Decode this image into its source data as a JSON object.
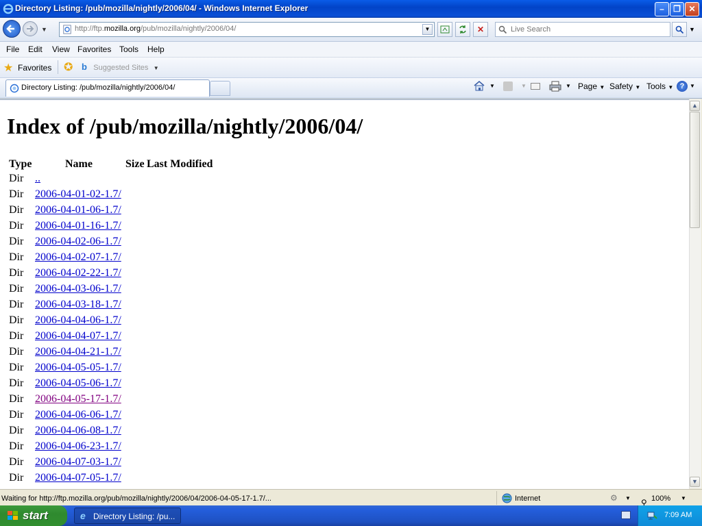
{
  "window": {
    "title": "Directory Listing: /pub/mozilla/nightly/2006/04/ - Windows Internet Explorer",
    "min_glyph": "–",
    "max_glyph": "❐",
    "close_glyph": "✕"
  },
  "navbar": {
    "url_prefix": "http://ftp.",
    "url_host": "mozilla.org",
    "url_path": "/pub/mozilla/nightly/2006/04/",
    "search_placeholder": "Live Search"
  },
  "menu": {
    "items": [
      "File",
      "Edit",
      "View",
      "Favorites",
      "Tools",
      "Help"
    ]
  },
  "favorites_bar": {
    "favorites_label": "Favorites",
    "suggested_label": "Suggested Sites"
  },
  "tabs": {
    "active_label": "Directory Listing: /pub/mozilla/nightly/2006/04/"
  },
  "command_bar": {
    "page": "Page",
    "safety": "Safety",
    "tools": "Tools"
  },
  "page": {
    "heading": "Index of /pub/mozilla/nightly/2006/04/",
    "columns": [
      "Type",
      "Name",
      "Size",
      "Last Modified"
    ],
    "rows": [
      {
        "type": "Dir",
        "name": ".."
      },
      {
        "type": "Dir",
        "name": "2006-04-01-02-1.7/"
      },
      {
        "type": "Dir",
        "name": "2006-04-01-06-1.7/"
      },
      {
        "type": "Dir",
        "name": "2006-04-01-16-1.7/"
      },
      {
        "type": "Dir",
        "name": "2006-04-02-06-1.7/"
      },
      {
        "type": "Dir",
        "name": "2006-04-02-07-1.7/"
      },
      {
        "type": "Dir",
        "name": "2006-04-02-22-1.7/"
      },
      {
        "type": "Dir",
        "name": "2006-04-03-06-1.7/"
      },
      {
        "type": "Dir",
        "name": "2006-04-03-18-1.7/"
      },
      {
        "type": "Dir",
        "name": "2006-04-04-06-1.7/"
      },
      {
        "type": "Dir",
        "name": "2006-04-04-07-1.7/"
      },
      {
        "type": "Dir",
        "name": "2006-04-04-21-1.7/"
      },
      {
        "type": "Dir",
        "name": "2006-04-05-05-1.7/"
      },
      {
        "type": "Dir",
        "name": "2006-04-05-06-1.7/"
      },
      {
        "type": "Dir",
        "name": "2006-04-05-17-1.7/",
        "visited": true
      },
      {
        "type": "Dir",
        "name": "2006-04-06-06-1.7/"
      },
      {
        "type": "Dir",
        "name": "2006-04-06-08-1.7/"
      },
      {
        "type": "Dir",
        "name": "2006-04-06-23-1.7/"
      },
      {
        "type": "Dir",
        "name": "2006-04-07-03-1.7/"
      },
      {
        "type": "Dir",
        "name": "2006-04-07-05-1.7/"
      }
    ],
    "link_color": "#0000cc",
    "visited_color": "#800080"
  },
  "status": {
    "text": "Waiting for http://ftp.mozilla.org/pub/mozilla/nightly/2006/04/2006-04-05-17-1.7/...",
    "zone": "Internet",
    "zoom": "100%"
  },
  "taskbar": {
    "start_label": "start",
    "task_label": "Directory Listing: /pu...",
    "clock": "7:09 AM"
  }
}
